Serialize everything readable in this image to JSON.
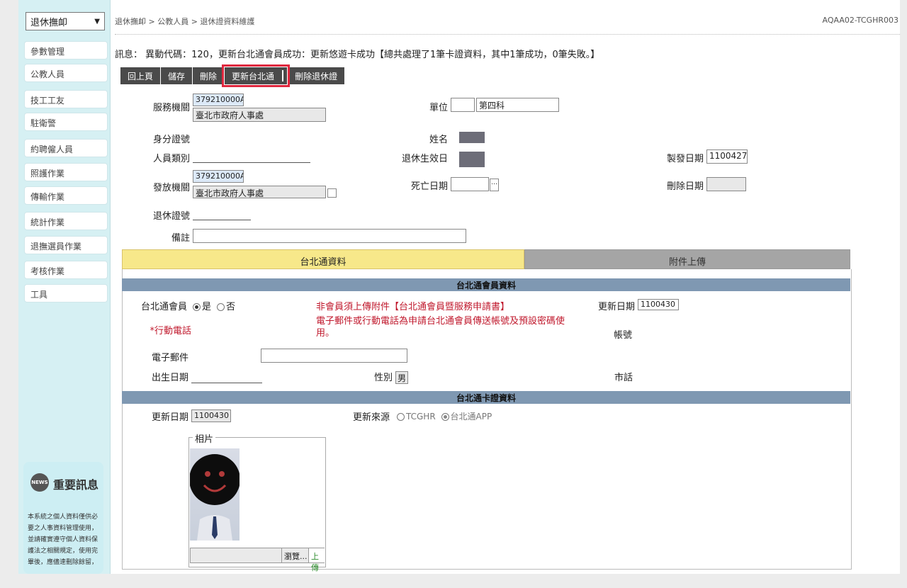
{
  "sidebar": {
    "select_value": "退休撫卹",
    "items": [
      {
        "label": "參數管理"
      },
      {
        "label": "公教人員"
      },
      {
        "label": "技工工友"
      },
      {
        "label": "駐衛警"
      },
      {
        "label": "約聘僱人員"
      },
      {
        "label": "照護作業"
      },
      {
        "label": "傳輸作業"
      },
      {
        "label": "統計作業"
      },
      {
        "label": "退撫選員作業"
      },
      {
        "label": "考核作業"
      },
      {
        "label": "工具"
      }
    ],
    "news": {
      "icon_text": "NEWS",
      "title": "重要訊息",
      "text": "本系統之個人資料僅供必要之人事資料管理使用，並請確實遵守個人資料保護法之相關規定，使用完畢後，應儘速刪除餘留，"
    }
  },
  "header": {
    "breadcrumb": "退休撫卹 > 公教人員 > 退休證資料維護",
    "program_code": "AQAA02-TCGHR003"
  },
  "message": "訊息： 異動代碼：120，更新台北通會員成功：更新悠遊卡成功【總共處理了1筆卡證資料，其中1筆成功，0筆失敗。】",
  "toolbar": {
    "back": "回上頁",
    "save": "儲存",
    "delete": "刪除",
    "update_taipei": "更新台北通",
    "delete_card": "刪除退休證"
  },
  "form": {
    "service_org_label": "服務機關",
    "service_org_code": "379210000A",
    "service_org_name": "臺北市政府人事處",
    "unit_label": "單位",
    "unit_value": "第四科",
    "id_label": "身分證號",
    "name_label": "姓名",
    "category_label": "人員類別",
    "retire_date_label": "退休生效日",
    "issue_date_label": "製發日期",
    "issue_date_value": "1100427",
    "issuing_org_label": "發放機關",
    "issuing_org_code": "379210000A",
    "issuing_org_name": "臺北市政府人事處",
    "death_date_label": "死亡日期",
    "delete_date_label": "刪除日期",
    "card_no_label": "退休證號",
    "remark_label": "備註"
  },
  "tabs": {
    "taipei": "台北通資料",
    "attach": "附件上傳"
  },
  "member_section": {
    "title": "台北通會員資料",
    "member_label": "台北通會員",
    "yes": "是",
    "no": "否",
    "notice1": "非會員須上傳附件【台北通會員暨服務申請書】",
    "notice2": "電子郵件或行動電話為申請台北通會員傳送帳號及預設密碼使用。",
    "update_date_label": "更新日期",
    "update_date_value": "1100430",
    "mobile_label": "*行動電話",
    "account_label": "帳號",
    "email_label": "電子郵件",
    "birth_label": "出生日期",
    "gender_label": "性別",
    "gender_value": "男",
    "city_label": "市話"
  },
  "card_section": {
    "title": "台北通卡證資料",
    "update_date_label": "更新日期",
    "update_date_value": "1100430",
    "source_label": "更新來源",
    "source_opt1": "TCGHR",
    "source_opt2": "台北通APP",
    "photo_legend": "相片",
    "browse": "瀏覽...",
    "upload": "上傳"
  },
  "colors": {
    "highlight": "#e0283f",
    "sidebar_bg": "#d6f0f3",
    "section_bar": "#7f98b2",
    "tab_active": "#f7e88a",
    "notice_red": "#c0182c"
  }
}
